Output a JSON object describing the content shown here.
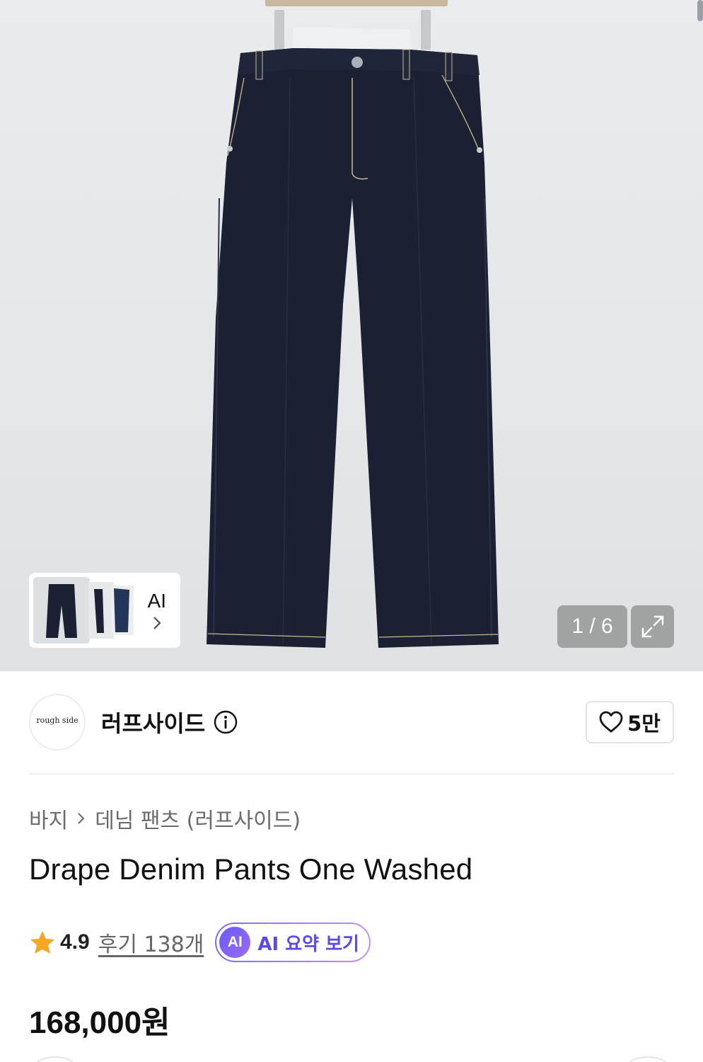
{
  "gallery": {
    "thumb_ai_label": "AI",
    "counter": "1 / 6",
    "image_alt_icon": "jeans-product-photo"
  },
  "brand": {
    "logo_text": "rough side",
    "name": "러프사이드",
    "likes": "5만"
  },
  "breadcrumb": {
    "category": "바지",
    "subcategory": "데님 팬츠 (러프사이드)"
  },
  "product": {
    "title": "Drape Denim Pants One Washed",
    "rating": "4.9",
    "reviews": "후기 138개",
    "ai_badge": "AI",
    "ai_summary_label": "AI 요약 보기",
    "price": "168,000원"
  },
  "colors": {
    "star": "#f5a623",
    "ai_gradient_start": "#6a5af9",
    "ai_gradient_end": "#c58ff2",
    "denim": "#1a1f30"
  }
}
